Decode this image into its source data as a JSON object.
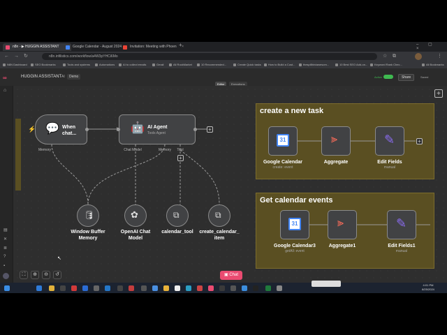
{
  "tabs": [
    {
      "label": "n8n - ▶ HUGGIN ASSISTANT",
      "color": "#ea4b71",
      "active": true
    },
    {
      "label": "Google Calendar - August 2024",
      "color": "#4285f4",
      "active": false
    },
    {
      "label": "Invitation: Meeting with Phoen",
      "color": "#ea4335",
      "active": false
    }
  ],
  "url": "n8n.infilistics.com/workflow/a4W3pYHCi6Mo",
  "bookmarks": [
    "N8N Dashboard",
    "SEO Bookmarks",
    "Tools and systems",
    "Automations",
    "AI to collect emails",
    "Gmail",
    "All RockMarket",
    "10 Recommended...",
    "Create Quick tasks",
    "How to Build a Cust...",
    "thespillbin/awesom...",
    "10 Best SEO Add-on...",
    "Keyword Rank Chec...",
    "All Bookmarks"
  ],
  "app": {
    "workflow_name": "HUGGIN ASSISTANT",
    "tag": "Demo",
    "tab_editor": "Editor",
    "tab_executions": "Executions",
    "active_label": "Active",
    "share_label": "Share",
    "saved_label": "Saved",
    "colors": {
      "accent": "#ea4b71",
      "sticky": "#5a4f22",
      "node": "#414244",
      "active_toggle": "#3fb950",
      "chat_button": "#ea4b71"
    }
  },
  "nodes": {
    "trigger": {
      "title_line1": "When",
      "title_line2": "chat...",
      "port_memory": "Memory"
    },
    "agent": {
      "title": "AI Agent",
      "subtitle": "Tools Agent",
      "port_model": "Chat Model",
      "port_memory": "Memory",
      "port_tool": "Tool"
    },
    "memory": {
      "line1": "Window Buffer",
      "line2": "Memory"
    },
    "openai": {
      "line1": "OpenAI Chat",
      "line2": "Model"
    },
    "tool1": {
      "label": "calendar_tool"
    },
    "tool2": {
      "line1": "create_calendar_",
      "line2": "item"
    }
  },
  "sticky1": {
    "title": "create a new task",
    "nodes": [
      {
        "label": "Google Calendar",
        "sub": "create: event"
      },
      {
        "label": "Aggregate",
        "sub": ""
      },
      {
        "label": "Edit Fields",
        "sub": "manual"
      }
    ]
  },
  "sticky2": {
    "title": "Get calendar events",
    "nodes": [
      {
        "label": "Google Calendar3",
        "sub": "getAll: event"
      },
      {
        "label": "Aggregate1",
        "sub": ""
      },
      {
        "label": "Edit Fields1",
        "sub": "manual"
      }
    ]
  },
  "chat_button": "Chat",
  "clock": {
    "time": "4:01 PM",
    "date": "8/25/2024"
  }
}
